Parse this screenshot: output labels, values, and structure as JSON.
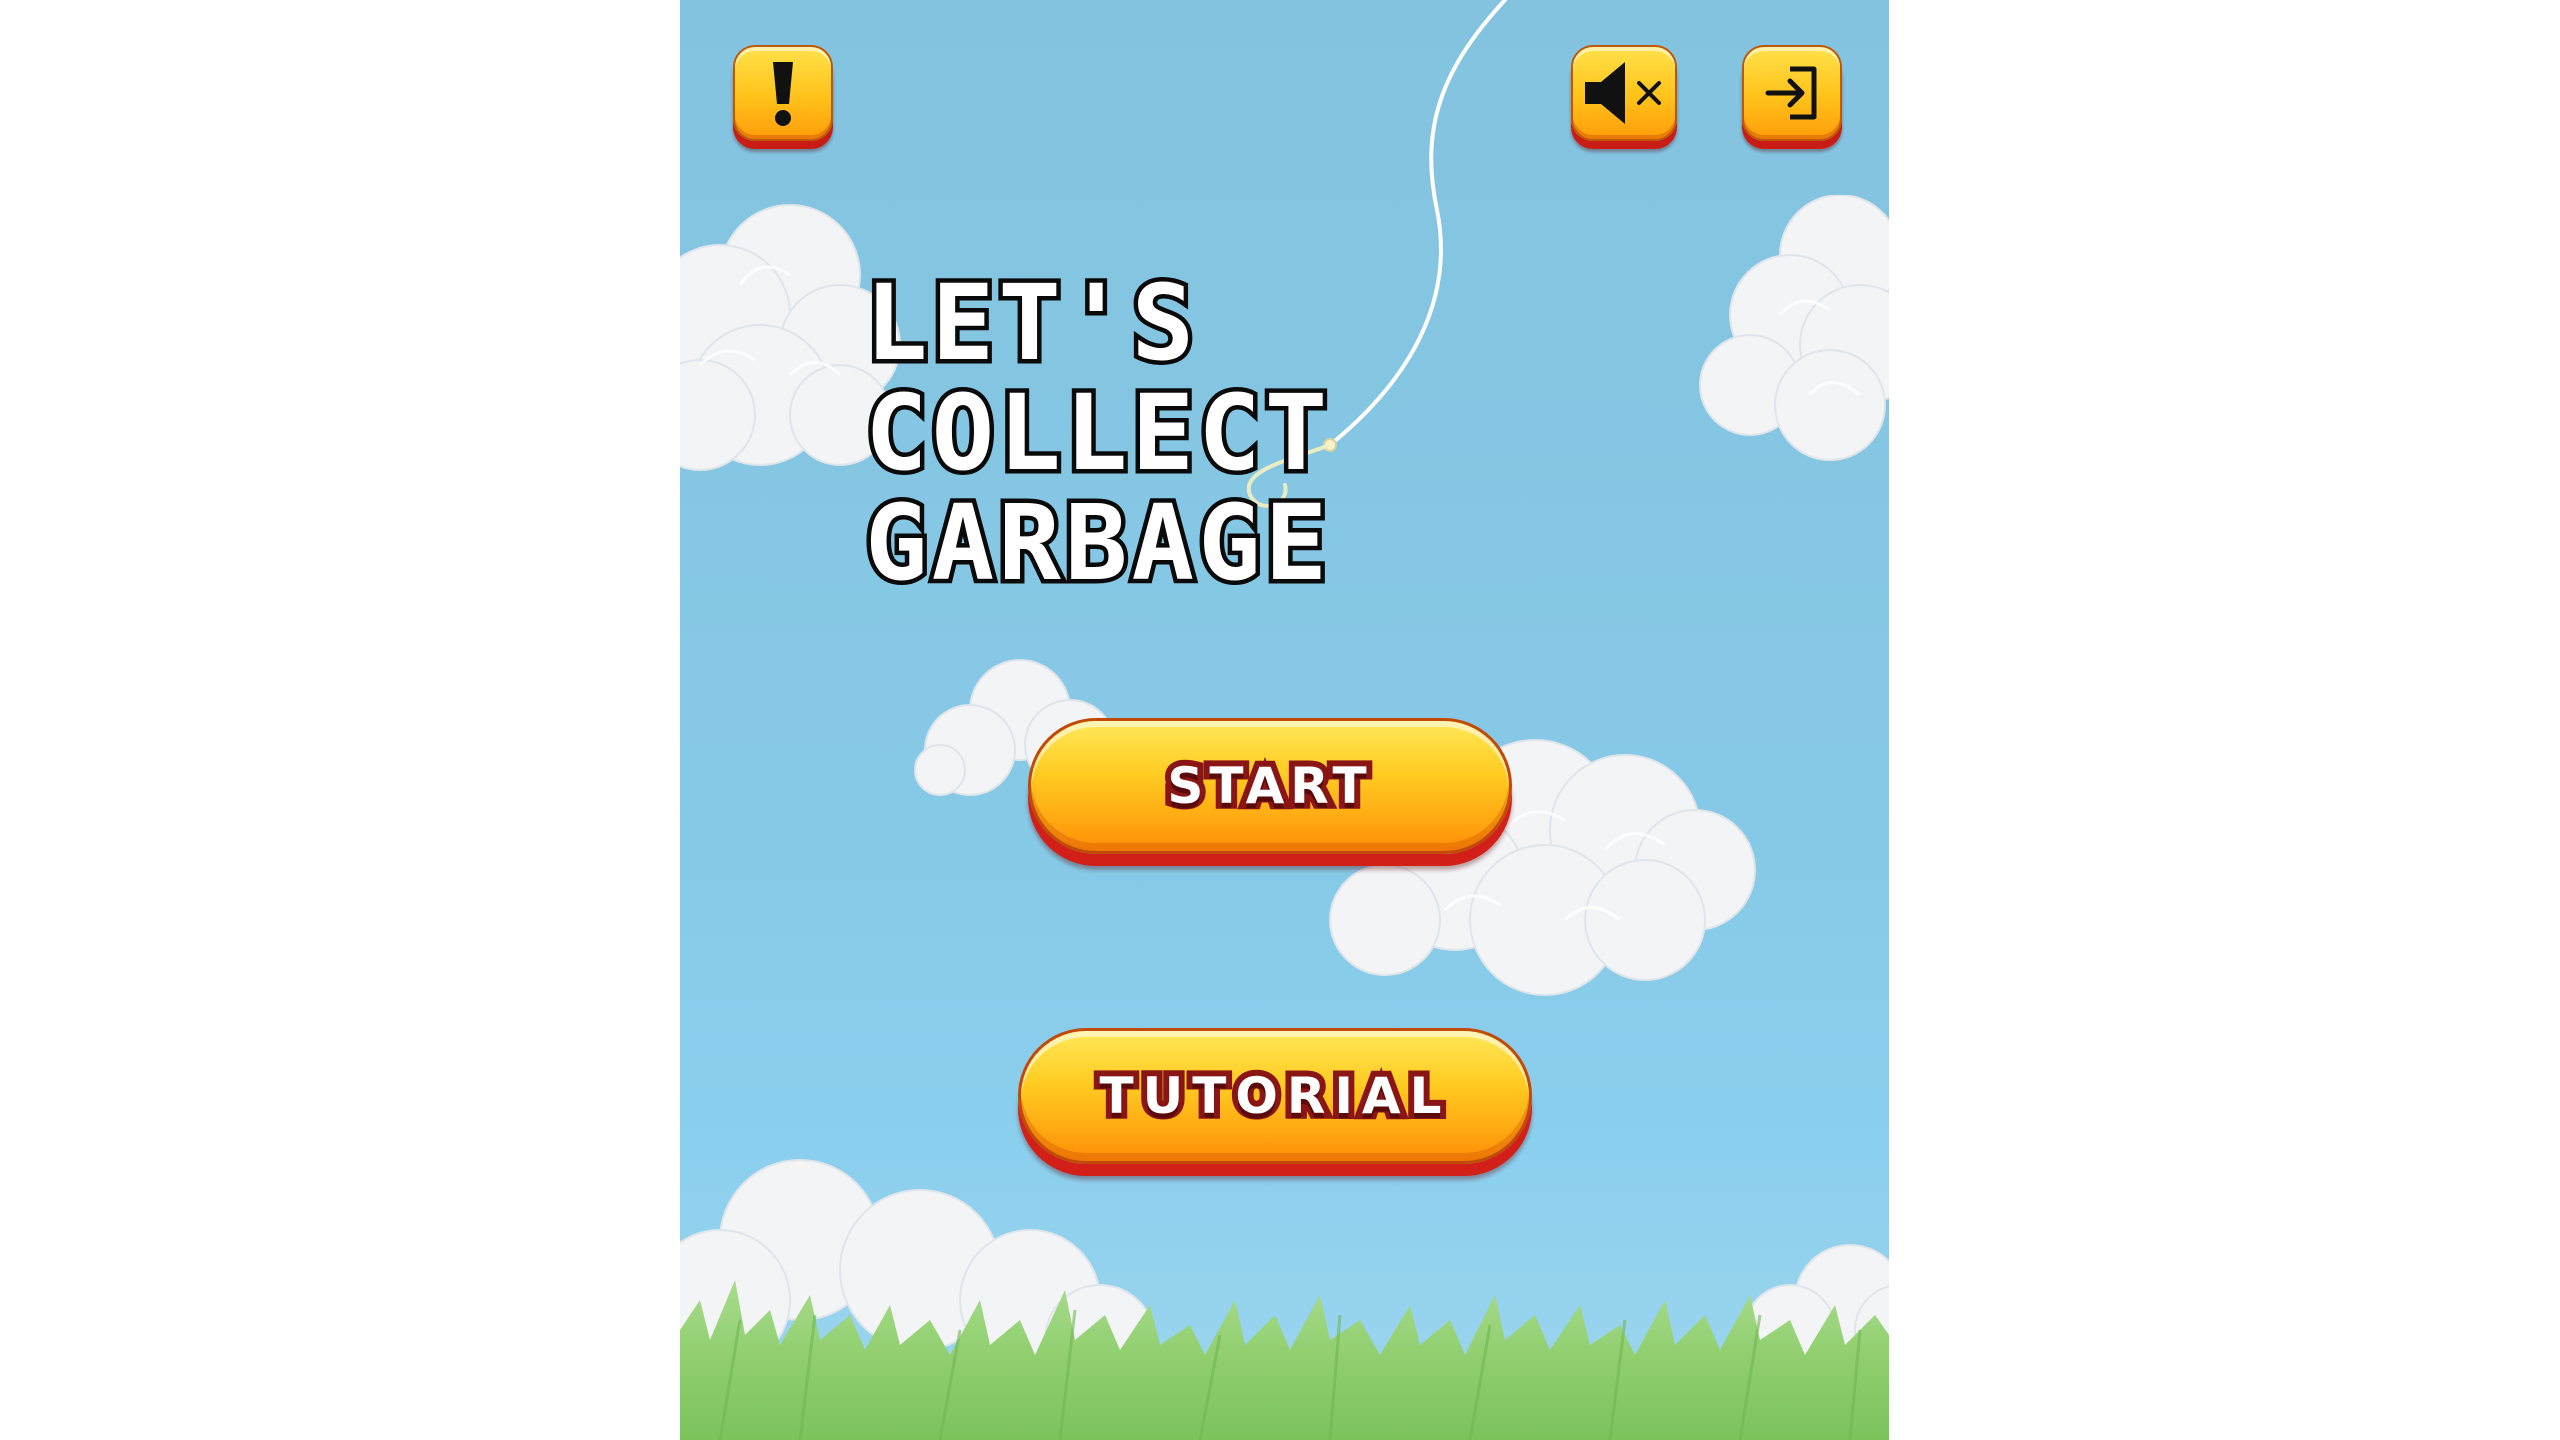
{
  "title_lines": [
    "LET'S",
    "COLLECT",
    "GARBAGE"
  ],
  "buttons": {
    "start_label": "START",
    "tutorial_label": "TUTORIAL"
  },
  "icons": {
    "alert": "exclamation-icon",
    "mute": "speaker-muted-icon",
    "exit": "exit-icon"
  },
  "colors": {
    "sky": "#86c9e6",
    "button_yellow": "#ffc21a",
    "button_shadow": "#d21f18",
    "label_outline": "#8a1515",
    "grass": "#8fce6e"
  }
}
